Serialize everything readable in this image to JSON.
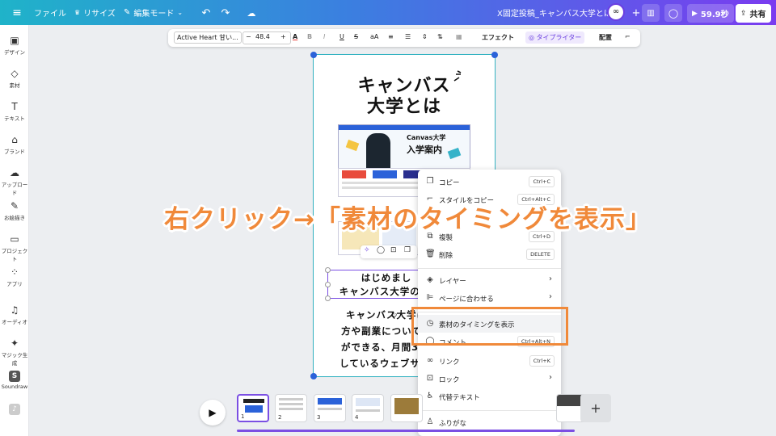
{
  "topbar": {
    "file": "ファイル",
    "resize": "リサイズ",
    "edit_mode": "編集モード",
    "doc_title": "X固定投稿_キャンバス大学とは",
    "timer": "59.9秒",
    "share": "共有"
  },
  "sidebar": {
    "items": [
      {
        "label": "デザイン",
        "icon": "design-icon"
      },
      {
        "label": "素材",
        "icon": "elements-icon"
      },
      {
        "label": "テキスト",
        "icon": "text-icon"
      },
      {
        "label": "ブランド",
        "icon": "brand-icon"
      },
      {
        "label": "アップロード",
        "icon": "upload-icon"
      },
      {
        "label": "お絵描き",
        "icon": "draw-icon"
      },
      {
        "label": "プロジェクト",
        "icon": "projects-icon"
      },
      {
        "label": "アプリ",
        "icon": "apps-icon"
      },
      {
        "label": "オーディオ",
        "icon": "audio-icon"
      },
      {
        "label": "マジック生成",
        "icon": "magic-icon"
      },
      {
        "label": "Soundraw",
        "icon": "soundraw-icon"
      }
    ]
  },
  "toolbar": {
    "font": "Active Heart 甘い...",
    "minus": "−",
    "font_size": "48.4",
    "plus": "+",
    "effect": "エフェクト",
    "typewriter": "タイプライター",
    "arrange": "配置"
  },
  "canvas": {
    "title_line1": "キャンバス",
    "title_line2": "大学とは",
    "banner_title1": "Canvas大学",
    "banner_title2": "入学案内",
    "text1": "はじめまし",
    "text2": "キャンバス大学のみ",
    "body1": "キャンバス大学は",
    "body2": "方や副業について",
    "body3": "ができる、月間3",
    "body4": "しているウェブサ"
  },
  "context_menu": {
    "items": [
      {
        "label": "コピー",
        "shortcut": "Ctrl+C",
        "icon": "copy-icon"
      },
      {
        "label": "スタイルをコピー",
        "shortcut": "Ctrl+Alt+C",
        "icon": "paint-icon"
      },
      {
        "label": "複製",
        "shortcut": "Ctrl+D",
        "icon": "duplicate-icon"
      },
      {
        "label": "削除",
        "shortcut": "DELETE",
        "icon": "trash-icon"
      },
      {
        "label": "レイヤー",
        "icon": "layers-icon"
      },
      {
        "label": "ページに合わせる",
        "icon": "align-icon"
      },
      {
        "label": "素材のタイミングを表示",
        "icon": "clock-icon"
      },
      {
        "label": "コメント",
        "shortcut": "Ctrl+Alt+N",
        "icon": "comment-icon"
      },
      {
        "label": "リンク",
        "shortcut": "Ctrl+K",
        "icon": "link-icon"
      },
      {
        "label": "ロック",
        "icon": "lock-icon"
      },
      {
        "label": "代替テキスト",
        "icon": "accessibility-icon"
      },
      {
        "label": "ふりがな",
        "icon": "furigana-icon"
      }
    ]
  },
  "overlay": {
    "text": "右クリック→「素材のタイミングを表示」",
    "color": "#f0893a"
  },
  "pages": {
    "thumbs": [
      "1",
      "2",
      "3",
      "4"
    ],
    "add": "+"
  }
}
